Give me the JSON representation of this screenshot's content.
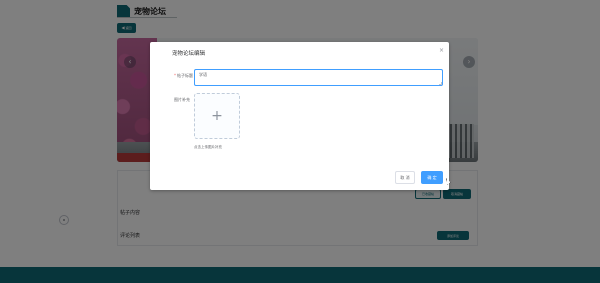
{
  "page": {
    "title": "宠物论坛",
    "back_label": "返回",
    "reply_heading": "帖子内容",
    "comments_heading": "评论列表",
    "collect_label": "已收藏帖",
    "uncollect_label": "取消藏帖",
    "comment_button": "添加评论"
  },
  "dialog": {
    "title": "宠物论坛编辑",
    "close_icon": "close-icon",
    "fields": {
      "title_label": "帖子标题",
      "title_value": "学语",
      "image_label": "图片补充",
      "upload_tip": "点击上传图片补充"
    },
    "buttons": {
      "cancel": "取 消",
      "confirm": "确 定"
    }
  },
  "colors": {
    "brand": "#0f6b77",
    "primary": "#409eff",
    "required": "#f56c6c"
  }
}
